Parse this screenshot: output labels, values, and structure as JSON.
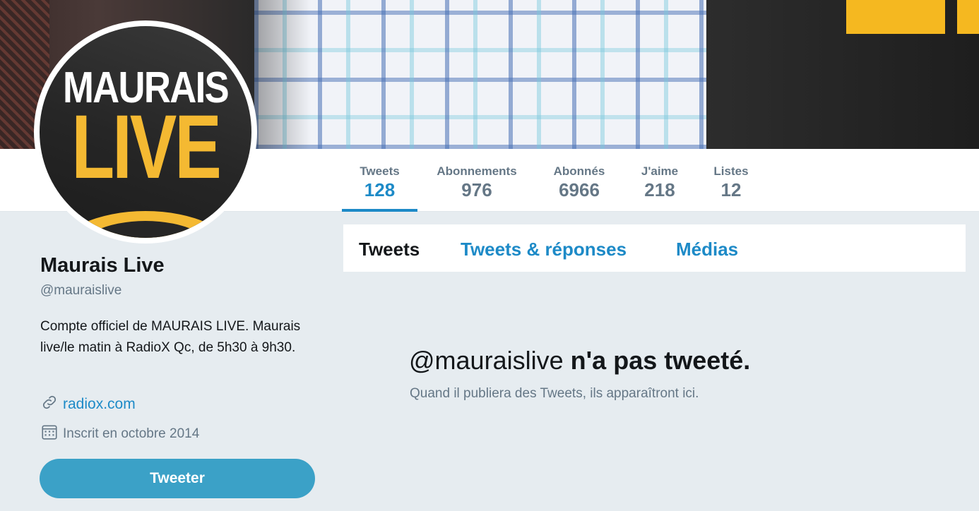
{
  "banner": {
    "accent_color": "#f5b820"
  },
  "avatar": {
    "line1": "MAURAIS",
    "line2": "LIVE"
  },
  "stats": [
    {
      "label": "Tweets",
      "value": "128",
      "active": true
    },
    {
      "label": "Abonnements",
      "value": "976"
    },
    {
      "label": "Abonnés",
      "value": "6966"
    },
    {
      "label": "J'aime",
      "value": "218"
    },
    {
      "label": "Listes",
      "value": "12"
    }
  ],
  "profile": {
    "name": "Maurais Live",
    "handle": "@mauraislive",
    "bio": "Compte officiel de MAURAIS LIVE. Maurais live/le matin à RadioX Qc, de 5h30 à 9h30.",
    "link": "radiox.com",
    "joined": "Inscrit en octobre 2014",
    "link_icon": "link-icon",
    "calendar_icon": "calendar-icon"
  },
  "actions": {
    "tweet_label": "Tweeter"
  },
  "tabs": [
    {
      "label": "Tweets",
      "active": true
    },
    {
      "label": "Tweets & réponses"
    },
    {
      "label": "Médias"
    }
  ],
  "empty": {
    "handle": "@mauraislive",
    "title_rest": "n'a pas tweeté.",
    "subtitle": "Quand il publiera des Tweets, ils apparaîtront ici."
  },
  "colors": {
    "link": "#1d8ac7",
    "muted": "#657786",
    "text": "#14171a",
    "button": "#3ba1c7",
    "background": "#e6ecf0"
  }
}
